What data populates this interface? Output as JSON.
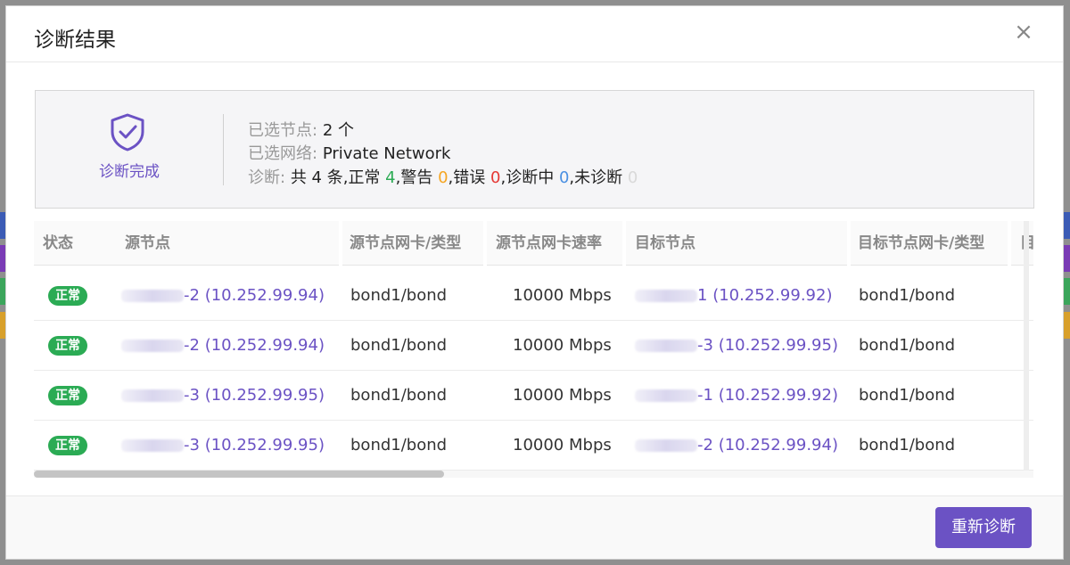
{
  "dialog": {
    "title": "诊断结果",
    "close_icon": "close-icon"
  },
  "summary": {
    "status_icon": "shield-check-icon",
    "status_label": "诊断完成",
    "selected_nodes_key": "已选节点:",
    "selected_nodes_value": "2 个",
    "selected_network_key": "已选网络:",
    "selected_network_value": "Private Network",
    "diag_key": "诊断:",
    "diag_total": "共 4 条,",
    "normal_label": "正常",
    "normal_count": "4",
    "warning_label": ",警告",
    "warning_count": "0",
    "error_label": ",错误",
    "error_count": "0",
    "running_label": ",诊断中",
    "running_count": "0",
    "pending_label": ",未诊断",
    "pending_count": "0",
    "colors": {
      "normal": "#2bab54",
      "warning": "#f5a623",
      "error": "#e53935",
      "running": "#4a90e2",
      "pending": "#d9d9d9"
    }
  },
  "table": {
    "columns": [
      "状态",
      "源节点",
      "源节点网卡/类型",
      "源节点网卡速率",
      "目标节点",
      "目标节点网卡/类型",
      "目"
    ],
    "rows": [
      {
        "status": "正常",
        "src_suffix": "-2",
        "src_ip": "(10.252.99.94)",
        "src_nic": "bond1/bond",
        "rate": "10000 Mbps",
        "dst_suffix": "1",
        "dst_ip": "(10.252.99.92)",
        "dst_nic": "bond1/bond"
      },
      {
        "status": "正常",
        "src_suffix": "-2",
        "src_ip": "(10.252.99.94)",
        "src_nic": "bond1/bond",
        "rate": "10000 Mbps",
        "dst_suffix": "-3",
        "dst_ip": "(10.252.99.95)",
        "dst_nic": "bond1/bond"
      },
      {
        "status": "正常",
        "src_suffix": "-3",
        "src_ip": "(10.252.99.95)",
        "src_nic": "bond1/bond",
        "rate": "10000 Mbps",
        "dst_suffix": "-1",
        "dst_ip": "(10.252.99.92)",
        "dst_nic": "bond1/bond"
      },
      {
        "status": "正常",
        "src_suffix": "-3",
        "src_ip": "(10.252.99.95)",
        "src_nic": "bond1/bond",
        "rate": "10000 Mbps",
        "dst_suffix": "-2",
        "dst_ip": "(10.252.99.94)",
        "dst_nic": "bond1/bond"
      }
    ]
  },
  "footer": {
    "rediagnose_label": "重新诊断"
  },
  "accent_color": "#6b52c4",
  "status_badge_color": "#2bab54"
}
